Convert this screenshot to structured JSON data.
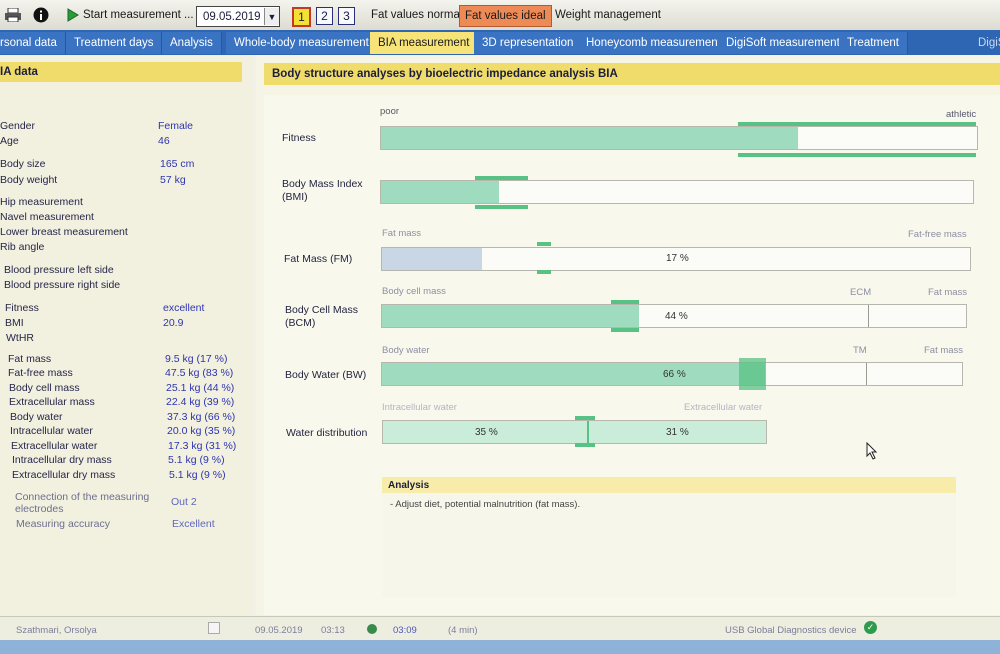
{
  "toolbar": {
    "start_label": "Start measurement ...",
    "date": "09.05.2019",
    "num1": "1",
    "num2": "2",
    "num3": "3",
    "fat_normal": "Fat values normal",
    "fat_ideal": "Fat values ideal",
    "weight_mgmt": "Weight management"
  },
  "tabs": [
    "rsonal data",
    "Treatment days",
    "Analysis",
    "Whole-body measurement",
    "BIA measurement",
    "3D representation",
    "Honeycomb measurement",
    "DigiSoft measurement",
    "Treatment",
    "DigiS"
  ],
  "left": {
    "title": "IA data",
    "gender_label": "Gender",
    "gender": "Female",
    "age_label": "Age",
    "age": "46",
    "size_label": "Body size",
    "size": "165 cm",
    "weight_label": "Body weight",
    "weight": "57 kg",
    "hip": "Hip measurement",
    "navel": "Navel measurement",
    "breast": "Lower breast measurement",
    "rib": "Rib angle",
    "bp_left": "Blood pressure left side",
    "bp_right": "Blood pressure right side",
    "fitness_label": "Fitness",
    "fitness": "excellent",
    "bmi_label": "BMI",
    "bmi": "20.9",
    "wthr_label": "WtHR",
    "metrics": [
      {
        "label": "Fat mass",
        "value": "9.5 kg (17 %)"
      },
      {
        "label": "Fat-free mass",
        "value": "47.5 kg (83 %)"
      },
      {
        "label": "Body cell mass",
        "value": "25.1 kg (44 %)"
      },
      {
        "label": "Extracellular mass",
        "value": "22.4 kg (39 %)"
      },
      {
        "label": "Body water",
        "value": "37.3 kg (66 %)"
      },
      {
        "label": "Intracellular water",
        "value": "20.0 kg (35 %)"
      },
      {
        "label": "Extracellular water",
        "value": "17.3 kg (31 %)"
      },
      {
        "label": "Intracellular dry mass",
        "value": "5.1 kg (9 %)"
      },
      {
        "label": "Extracellular dry mass",
        "value": "5.1 kg (9 %)"
      }
    ],
    "connection_label": "Connection of the measuring electrodes",
    "connection": "Out 2",
    "accuracy_label": "Measuring accuracy",
    "accuracy": "Excellent"
  },
  "main": {
    "title": "Body structure analyses by bioelectric impedance analysis BIA",
    "poor": "poor",
    "athletic": "athletic",
    "fitness_label": "Fitness",
    "bmi_label": "Body Mass Index (BMI)",
    "fm_label": "Fat Mass (FM)",
    "fm_left": "Fat mass",
    "fm_right": "Fat-free mass",
    "fm_value": "17 %",
    "bcm_label": "Body Cell Mass (BCM)",
    "bcm_left": "Body cell mass",
    "bcm_mid": "ECM",
    "bcm_right": "Fat mass",
    "bcm_value": "44 %",
    "bw_label": "Body Water (BW)",
    "bw_left": "Body water",
    "bw_mid": "TM",
    "bw_right": "Fat mass",
    "bw_value": "66 %",
    "wd_label": "Water distribution",
    "wd_left": "Intracellular water",
    "wd_right": "Extracellular water",
    "wd_icw": "35 %",
    "wd_ecw": "31 %",
    "analysis_title": "Analysis",
    "analysis_text": "- Adjust diet, potential malnutrition (fat mass)."
  },
  "levels": {
    "fitness": 0.7,
    "bmi": 0.2,
    "fat_mass": 0.17,
    "body_cell_mass": 0.44,
    "body_water": 0.66
  },
  "status": {
    "user": "Szathmari, Orsolya",
    "date": "09.05.2019",
    "time": "03:13",
    "time2": "03:09",
    "duration": "(4 min)",
    "device": "USB Global Diagnostics device"
  }
}
